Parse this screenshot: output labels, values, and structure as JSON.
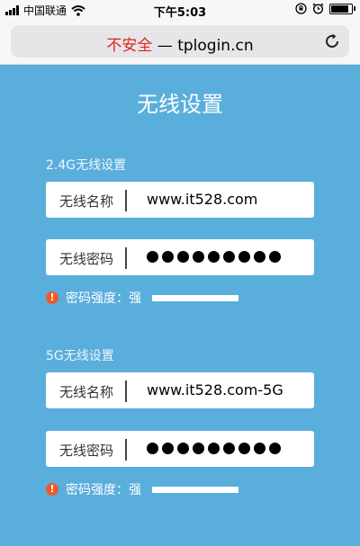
{
  "status_bar": {
    "carrier": "中国联通",
    "time": "下午5:03"
  },
  "url_bar": {
    "insecure_label": "不安全",
    "separator": "—",
    "domain": "tplogin.cn"
  },
  "page": {
    "title": "无线设置",
    "band_24": {
      "section_label": "2.4G无线设置",
      "ssid_label": "无线名称",
      "ssid_value": "www.it528.com",
      "password_label": "无线密码",
      "password_dot_count": 9,
      "strength_label": "密码强度：强",
      "strength_level": 1.0
    },
    "band_5": {
      "section_label": "5G无线设置",
      "ssid_label": "无线名称",
      "ssid_value": "www.it528.com-5G",
      "password_label": "无线密码",
      "password_dot_count": 9,
      "strength_label": "密码强度：强",
      "strength_level": 1.0
    }
  },
  "colors": {
    "background": "#5aaedc",
    "insecure": "#e0231c",
    "warning": "#f05a28"
  }
}
